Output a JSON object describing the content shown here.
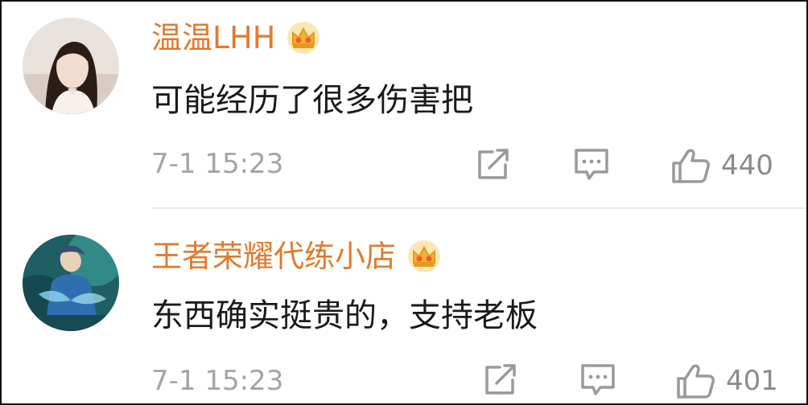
{
  "comments": [
    {
      "username": "温温LHH",
      "text": "可能经历了很多伤害把",
      "timestamp": "7-1 15:23",
      "likes": "440",
      "badge_icon": "vip-crown-icon",
      "avatar": "user-avatar"
    },
    {
      "username": "王者荣耀代练小店",
      "text": "东西确实挺贵的，支持老板",
      "timestamp": "7-1 15:23",
      "likes": "401",
      "badge_icon": "vip-crown-icon",
      "avatar": "game-character-avatar"
    }
  ],
  "colors": {
    "username": "#e07b2e",
    "content": "#1a1a1a",
    "timestamp": "#a4a4a4",
    "icon": "#9a9a9a",
    "crown": "#f3b32e",
    "divider": "#e9e9e9"
  },
  "icons": {
    "repost": "repost-icon",
    "comment": "comment-icon",
    "like": "thumbs-up-icon"
  }
}
